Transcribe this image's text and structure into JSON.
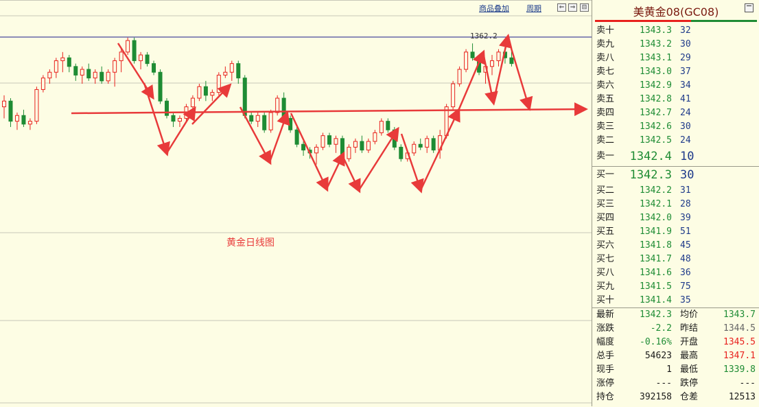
{
  "toolbar": {
    "overlay_label": "商品叠加",
    "period_label": "周期",
    "btn_left": "⇐",
    "btn_right": "⇒",
    "btn_fit": "⊟"
  },
  "chart": {
    "caption": "黄金日线图",
    "peak_label": "1362.2",
    "colors": {
      "up": "#e8201c",
      "down": "#1e8c34",
      "arrow": "#e83a3a",
      "resistance": "#1a1a8a",
      "grid": "#c8c8b8"
    }
  },
  "chart_data": {
    "type": "candlestick",
    "title": "黄金日线图",
    "series": [
      {
        "candles": [
          {
            "o": 1338,
            "h": 1342,
            "l": 1334,
            "c": 1340
          },
          {
            "o": 1340,
            "h": 1341,
            "l": 1331,
            "c": 1333
          },
          {
            "o": 1333,
            "h": 1336,
            "l": 1330,
            "c": 1335
          },
          {
            "o": 1335,
            "h": 1337,
            "l": 1331,
            "c": 1332
          },
          {
            "o": 1332,
            "h": 1334,
            "l": 1330,
            "c": 1333
          },
          {
            "o": 1333,
            "h": 1345,
            "l": 1332,
            "c": 1344
          },
          {
            "o": 1344,
            "h": 1349,
            "l": 1343,
            "c": 1348
          },
          {
            "o": 1348,
            "h": 1351,
            "l": 1346,
            "c": 1350
          },
          {
            "o": 1350,
            "h": 1355,
            "l": 1348,
            "c": 1354
          },
          {
            "o": 1354,
            "h": 1357,
            "l": 1350,
            "c": 1355
          },
          {
            "o": 1355,
            "h": 1356,
            "l": 1350,
            "c": 1352
          },
          {
            "o": 1352,
            "h": 1353,
            "l": 1347,
            "c": 1349
          },
          {
            "o": 1349,
            "h": 1352,
            "l": 1346,
            "c": 1351
          },
          {
            "o": 1351,
            "h": 1353,
            "l": 1347,
            "c": 1348
          },
          {
            "o": 1348,
            "h": 1351,
            "l": 1346,
            "c": 1350
          },
          {
            "o": 1350,
            "h": 1352,
            "l": 1346,
            "c": 1347
          },
          {
            "o": 1347,
            "h": 1351,
            "l": 1346,
            "c": 1350
          },
          {
            "o": 1350,
            "h": 1355,
            "l": 1345,
            "c": 1354
          },
          {
            "o": 1354,
            "h": 1358,
            "l": 1350,
            "c": 1357
          },
          {
            "o": 1357,
            "h": 1362,
            "l": 1356,
            "c": 1361
          },
          {
            "o": 1361,
            "h": 1362,
            "l": 1353,
            "c": 1354
          },
          {
            "o": 1354,
            "h": 1357,
            "l": 1351,
            "c": 1356
          },
          {
            "o": 1356,
            "h": 1357,
            "l": 1352,
            "c": 1353
          },
          {
            "o": 1353,
            "h": 1354,
            "l": 1349,
            "c": 1350
          },
          {
            "o": 1350,
            "h": 1351,
            "l": 1339,
            "c": 1340
          },
          {
            "o": 1340,
            "h": 1341,
            "l": 1334,
            "c": 1335
          },
          {
            "o": 1335,
            "h": 1336,
            "l": 1331,
            "c": 1333
          },
          {
            "o": 1333,
            "h": 1335,
            "l": 1331,
            "c": 1334
          },
          {
            "o": 1334,
            "h": 1339,
            "l": 1333,
            "c": 1338
          },
          {
            "o": 1338,
            "h": 1342,
            "l": 1337,
            "c": 1341
          },
          {
            "o": 1341,
            "h": 1346,
            "l": 1340,
            "c": 1345
          },
          {
            "o": 1345,
            "h": 1347,
            "l": 1340,
            "c": 1342
          },
          {
            "o": 1342,
            "h": 1344,
            "l": 1340,
            "c": 1343
          },
          {
            "o": 1343,
            "h": 1350,
            "l": 1342,
            "c": 1349
          },
          {
            "o": 1349,
            "h": 1352,
            "l": 1348,
            "c": 1350
          },
          {
            "o": 1350,
            "h": 1354,
            "l": 1347,
            "c": 1353
          },
          {
            "o": 1353,
            "h": 1354,
            "l": 1346,
            "c": 1348
          },
          {
            "o": 1348,
            "h": 1349,
            "l": 1334,
            "c": 1335
          },
          {
            "o": 1335,
            "h": 1336,
            "l": 1332,
            "c": 1333
          },
          {
            "o": 1333,
            "h": 1336,
            "l": 1331,
            "c": 1335
          },
          {
            "o": 1335,
            "h": 1336,
            "l": 1329,
            "c": 1330
          },
          {
            "o": 1330,
            "h": 1337,
            "l": 1329,
            "c": 1336
          },
          {
            "o": 1336,
            "h": 1342,
            "l": 1335,
            "c": 1341
          },
          {
            "o": 1341,
            "h": 1343,
            "l": 1333,
            "c": 1334
          },
          {
            "o": 1334,
            "h": 1335,
            "l": 1329,
            "c": 1330
          },
          {
            "o": 1330,
            "h": 1331,
            "l": 1324,
            "c": 1325
          },
          {
            "o": 1325,
            "h": 1326,
            "l": 1321,
            "c": 1323
          },
          {
            "o": 1323,
            "h": 1324,
            "l": 1320,
            "c": 1322
          },
          {
            "o": 1322,
            "h": 1325,
            "l": 1318,
            "c": 1324
          },
          {
            "o": 1324,
            "h": 1329,
            "l": 1323,
            "c": 1328
          },
          {
            "o": 1328,
            "h": 1329,
            "l": 1324,
            "c": 1325
          },
          {
            "o": 1325,
            "h": 1328,
            "l": 1322,
            "c": 1327
          },
          {
            "o": 1327,
            "h": 1328,
            "l": 1319,
            "c": 1320
          },
          {
            "o": 1320,
            "h": 1325,
            "l": 1319,
            "c": 1324
          },
          {
            "o": 1324,
            "h": 1327,
            "l": 1322,
            "c": 1326
          },
          {
            "o": 1326,
            "h": 1328,
            "l": 1322,
            "c": 1323
          },
          {
            "o": 1323,
            "h": 1327,
            "l": 1322,
            "c": 1326
          },
          {
            "o": 1326,
            "h": 1330,
            "l": 1325,
            "c": 1329
          },
          {
            "o": 1329,
            "h": 1334,
            "l": 1328,
            "c": 1333
          },
          {
            "o": 1333,
            "h": 1334,
            "l": 1329,
            "c": 1330
          },
          {
            "o": 1330,
            "h": 1331,
            "l": 1323,
            "c": 1324
          },
          {
            "o": 1324,
            "h": 1325,
            "l": 1319,
            "c": 1320
          },
          {
            "o": 1320,
            "h": 1323,
            "l": 1319,
            "c": 1322
          },
          {
            "o": 1322,
            "h": 1326,
            "l": 1321,
            "c": 1325
          },
          {
            "o": 1325,
            "h": 1327,
            "l": 1323,
            "c": 1324
          },
          {
            "o": 1324,
            "h": 1328,
            "l": 1322,
            "c": 1327
          },
          {
            "o": 1327,
            "h": 1328,
            "l": 1322,
            "c": 1323
          },
          {
            "o": 1323,
            "h": 1330,
            "l": 1320,
            "c": 1328
          },
          {
            "o": 1328,
            "h": 1339,
            "l": 1327,
            "c": 1338
          },
          {
            "o": 1338,
            "h": 1347,
            "l": 1337,
            "c": 1346
          },
          {
            "o": 1346,
            "h": 1352,
            "l": 1345,
            "c": 1351
          },
          {
            "o": 1351,
            "h": 1358,
            "l": 1350,
            "c": 1357
          },
          {
            "o": 1357,
            "h": 1360,
            "l": 1354,
            "c": 1355
          },
          {
            "o": 1355,
            "h": 1356,
            "l": 1349,
            "c": 1350
          },
          {
            "o": 1350,
            "h": 1353,
            "l": 1346,
            "c": 1352
          },
          {
            "o": 1352,
            "h": 1356,
            "l": 1349,
            "c": 1354
          },
          {
            "o": 1354,
            "h": 1358,
            "l": 1352,
            "c": 1357
          },
          {
            "o": 1357,
            "h": 1359,
            "l": 1353,
            "c": 1355
          },
          {
            "o": 1355,
            "h": 1358,
            "l": 1352,
            "c": 1353
          }
        ]
      }
    ]
  },
  "quote": {
    "title": "美黄金08(GC08)",
    "asks": [
      {
        "label": "卖十",
        "price": "1343.3",
        "qty": "32"
      },
      {
        "label": "卖九",
        "price": "1343.2",
        "qty": "30"
      },
      {
        "label": "卖八",
        "price": "1343.1",
        "qty": "29"
      },
      {
        "label": "卖七",
        "price": "1343.0",
        "qty": "37"
      },
      {
        "label": "卖六",
        "price": "1342.9",
        "qty": "34"
      },
      {
        "label": "卖五",
        "price": "1342.8",
        "qty": "41"
      },
      {
        "label": "卖四",
        "price": "1342.7",
        "qty": "24"
      },
      {
        "label": "卖三",
        "price": "1342.6",
        "qty": "30"
      },
      {
        "label": "卖二",
        "price": "1342.5",
        "qty": "24"
      },
      {
        "label": "卖一",
        "price": "1342.4",
        "qty": "10"
      }
    ],
    "bids": [
      {
        "label": "买一",
        "price": "1342.3",
        "qty": "30"
      },
      {
        "label": "买二",
        "price": "1342.2",
        "qty": "31"
      },
      {
        "label": "买三",
        "price": "1342.1",
        "qty": "28"
      },
      {
        "label": "买四",
        "price": "1342.0",
        "qty": "39"
      },
      {
        "label": "买五",
        "price": "1341.9",
        "qty": "51"
      },
      {
        "label": "买六",
        "price": "1341.8",
        "qty": "45"
      },
      {
        "label": "买七",
        "price": "1341.7",
        "qty": "48"
      },
      {
        "label": "买八",
        "price": "1341.6",
        "qty": "36"
      },
      {
        "label": "买九",
        "price": "1341.5",
        "qty": "75"
      },
      {
        "label": "买十",
        "price": "1341.4",
        "qty": "35"
      }
    ],
    "stats": [
      {
        "l1": "最新",
        "v1": "1342.3",
        "c1": "green",
        "l2": "均价",
        "v2": "1343.7",
        "c2": "green"
      },
      {
        "l1": "涨跌",
        "v1": "-2.2",
        "c1": "green",
        "l2": "昨结",
        "v2": "1344.5",
        "c2": "gray"
      },
      {
        "l1": "幅度",
        "v1": "-0.16%",
        "c1": "green",
        "l2": "开盘",
        "v2": "1345.5",
        "c2": "red"
      },
      {
        "l1": "总手",
        "v1": "54623",
        "c1": "dark",
        "l2": "最高",
        "v2": "1347.1",
        "c2": "red"
      },
      {
        "l1": "现手",
        "v1": "1",
        "c1": "dark",
        "l2": "最低",
        "v2": "1339.8",
        "c2": "green"
      },
      {
        "l1": "涨停",
        "v1": "---",
        "c1": "dark",
        "l2": "跌停",
        "v2": "---",
        "c2": "dark"
      },
      {
        "l1": "持仓",
        "v1": "392158",
        "c1": "dark",
        "l2": "仓差",
        "v2": "12513",
        "c2": "dark"
      }
    ]
  }
}
